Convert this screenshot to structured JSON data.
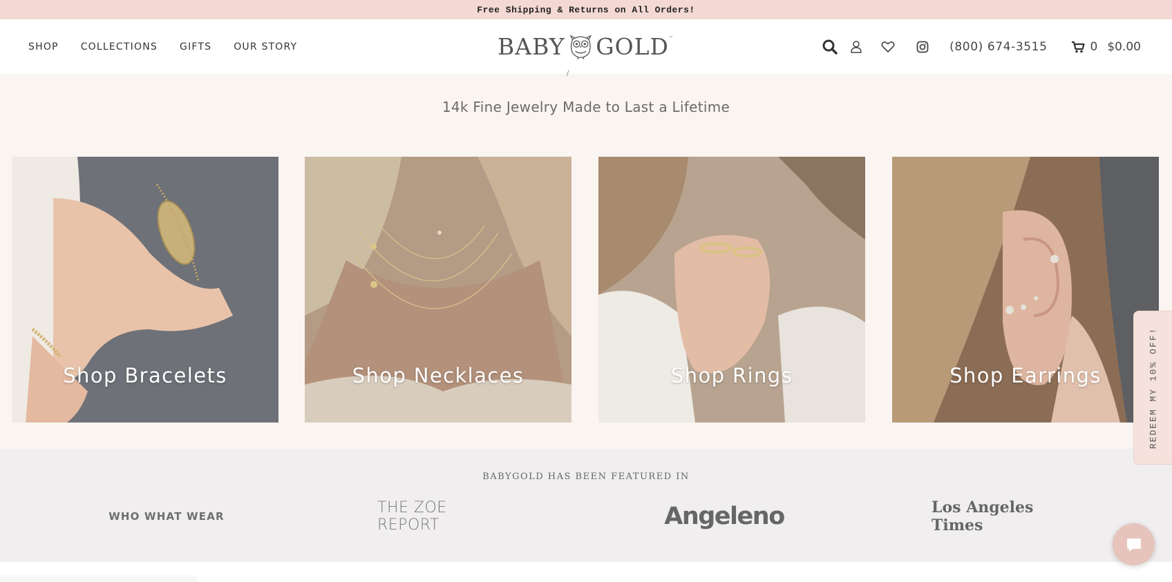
{
  "promo_bar": {
    "text": "Free Shipping & Returns on All Orders!"
  },
  "header": {
    "nav": [
      "SHOP",
      "COLLECTIONS",
      "GIFTS",
      "OUR STORY"
    ],
    "logo": {
      "left": "BABY",
      "right": "GOLD",
      "tm": "™"
    },
    "icons": [
      "search-icon",
      "account-icon",
      "wishlist-heart-icon",
      "instagram-icon"
    ],
    "phone": "(800) 674-3515",
    "cart": {
      "count": "0",
      "total": "$0.00"
    }
  },
  "hero": {
    "breadcrumb_fragment": "/",
    "tagline": "14k Fine Jewelry Made to Last a Lifetime",
    "tiles": [
      {
        "label": "Shop Bracelets"
      },
      {
        "label": "Shop Necklaces"
      },
      {
        "label": "Shop Rings"
      },
      {
        "label": "Shop Earrings"
      }
    ]
  },
  "featured": {
    "title": "BABYGOLD HAS BEEN FEATURED IN",
    "press": [
      "WHO WHAT WEAR",
      "THE ZOE REPORT",
      "Angeleno",
      "Los Angeles Times"
    ]
  },
  "redeem_tab": {
    "text": "REDEEM MY 10% OFF!"
  },
  "colors": {
    "promo_bg": "#f3d8d3",
    "hero_bg": "#fbf5f1",
    "featured_bg": "#f0eeef",
    "chat_bg": "#e6c4bc"
  }
}
